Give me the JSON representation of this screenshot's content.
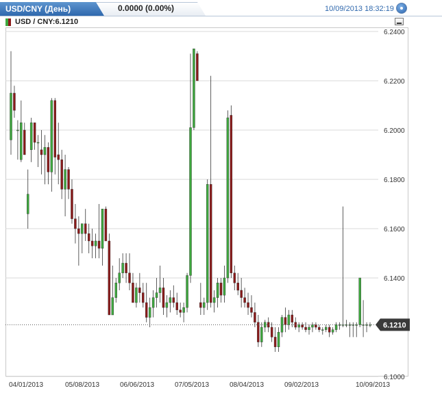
{
  "header": {
    "title": "USD/CNY (День)",
    "change": "0.0000 (0.00%)",
    "timestamp": "10/09/2013 18:32:19"
  },
  "legend": {
    "label": "USD / CNY:6.1210"
  },
  "colors": {
    "up": "#3ea83e",
    "down": "#8b1a1a",
    "accent": "#2f68ad",
    "price_marker": "#3a3a3a"
  },
  "chart_data": {
    "type": "candlestick",
    "title": "USD / CNY",
    "x_tick_labels": [
      "04/01/2013",
      "05/08/2013",
      "06/06/2013",
      "07/05/2013",
      "08/04/2013",
      "09/02/2013",
      "10/09/2013"
    ],
    "y_tick_labels": [
      "6.2400",
      "6.2200",
      "6.2000",
      "6.1800",
      "6.1600",
      "6.1400",
      "6.1210",
      "6.1000"
    ],
    "ylim": [
      6.1,
      6.24
    ],
    "last_price": 6.121,
    "last_price_label": "6.1210",
    "grid": true,
    "candles": [
      [
        6.196,
        6.232,
        6.19,
        6.215
      ],
      [
        6.215,
        6.218,
        6.205,
        6.208
      ],
      [
        6.2,
        6.204,
        6.188,
        6.2
      ],
      [
        6.188,
        6.212,
        6.187,
        6.203
      ],
      [
        6.2,
        6.203,
        6.195,
        6.19
      ],
      [
        6.166,
        6.184,
        6.16,
        6.174
      ],
      [
        6.192,
        6.205,
        6.187,
        6.203
      ],
      [
        6.203,
        6.2,
        6.192,
        6.195
      ],
      [
        6.195,
        6.198,
        6.185,
        6.195
      ],
      [
        6.192,
        6.2,
        6.182,
        6.19
      ],
      [
        6.19,
        6.198,
        6.178,
        6.193
      ],
      [
        6.193,
        6.195,
        6.178,
        6.183
      ],
      [
        6.183,
        6.213,
        6.175,
        6.212
      ],
      [
        6.212,
        6.213,
        6.182,
        6.189
      ],
      [
        6.19,
        6.203,
        6.178,
        6.188
      ],
      [
        6.188,
        6.192,
        6.172,
        6.176
      ],
      [
        6.176,
        6.19,
        6.165,
        6.184
      ],
      [
        6.184,
        6.185,
        6.172,
        6.176
      ],
      [
        6.176,
        6.18,
        6.162,
        6.164
      ],
      [
        6.164,
        6.17,
        6.154,
        6.16
      ],
      [
        6.16,
        6.165,
        6.145,
        6.158
      ],
      [
        6.158,
        6.162,
        6.15,
        6.162
      ],
      [
        6.162,
        6.168,
        6.155,
        6.158
      ],
      [
        6.158,
        6.162,
        6.15,
        6.155
      ],
      [
        6.155,
        6.16,
        6.148,
        6.153
      ],
      [
        6.153,
        6.158,
        6.148,
        6.155
      ],
      [
        6.155,
        6.17,
        6.148,
        6.152
      ],
      [
        6.152,
        6.166,
        6.145,
        6.168
      ],
      [
        6.168,
        6.169,
        6.158,
        6.155
      ],
      [
        6.155,
        6.158,
        6.125,
        6.125
      ],
      [
        6.125,
        6.145,
        6.125,
        6.132
      ],
      [
        6.132,
        6.14,
        6.13,
        6.138
      ],
      [
        6.138,
        6.148,
        6.135,
        6.142
      ],
      [
        6.142,
        6.15,
        6.14,
        6.146
      ],
      [
        6.146,
        6.15,
        6.138,
        6.142
      ],
      [
        6.142,
        6.15,
        6.135,
        6.138
      ],
      [
        6.138,
        6.142,
        6.13,
        6.13
      ],
      [
        6.13,
        6.138,
        6.128,
        6.136
      ],
      [
        6.136,
        6.142,
        6.13,
        6.134
      ],
      [
        6.134,
        6.138,
        6.128,
        6.13
      ],
      [
        6.13,
        6.138,
        6.122,
        6.124
      ],
      [
        6.124,
        6.132,
        6.12,
        6.128
      ],
      [
        6.128,
        6.135,
        6.124,
        6.132
      ],
      [
        6.132,
        6.14,
        6.128,
        6.134
      ],
      [
        6.134,
        6.145,
        6.13,
        6.136
      ],
      [
        6.136,
        6.14,
        6.125,
        6.128
      ],
      [
        6.128,
        6.133,
        6.124,
        6.13
      ],
      [
        6.13,
        6.135,
        6.126,
        6.132
      ],
      [
        6.132,
        6.137,
        6.128,
        6.13
      ],
      [
        6.13,
        6.134,
        6.125,
        6.127
      ],
      [
        6.127,
        6.13,
        6.124,
        6.126
      ],
      [
        6.126,
        6.13,
        6.122,
        6.128
      ],
      [
        6.128,
        6.142,
        6.126,
        6.141
      ],
      [
        6.141,
        6.231,
        6.138,
        6.201
      ],
      [
        6.201,
        6.233,
        6.2,
        6.233
      ],
      [
        6.231,
        6.232,
        6.22,
        6.22
      ],
      [
        6.13,
        6.138,
        6.125,
        6.128
      ],
      [
        6.128,
        6.132,
        6.125,
        6.13
      ],
      [
        6.13,
        6.18,
        6.127,
        6.178
      ],
      [
        6.178,
        6.222,
        6.128,
        6.13
      ],
      [
        6.13,
        6.135,
        6.126,
        6.132
      ],
      [
        6.132,
        6.14,
        6.128,
        6.138
      ],
      [
        6.138,
        6.14,
        6.13,
        6.133
      ],
      [
        6.133,
        6.145,
        6.13,
        6.14
      ],
      [
        6.14,
        6.208,
        6.138,
        6.205
      ],
      [
        6.206,
        6.21,
        6.14,
        6.142
      ],
      [
        6.142,
        6.145,
        6.135,
        6.138
      ],
      [
        6.138,
        6.142,
        6.133,
        6.135
      ],
      [
        6.135,
        6.14,
        6.128,
        6.132
      ],
      [
        6.132,
        6.136,
        6.128,
        6.13
      ],
      [
        6.13,
        6.134,
        6.125,
        6.128
      ],
      [
        6.128,
        6.133,
        6.124,
        6.126
      ],
      [
        6.126,
        6.13,
        6.12,
        6.122
      ],
      [
        6.122,
        6.125,
        6.112,
        6.114
      ],
      [
        6.114,
        6.122,
        6.112,
        6.12
      ],
      [
        6.12,
        6.123,
        6.118,
        6.122
      ],
      [
        6.122,
        6.124,
        6.118,
        6.12
      ],
      [
        6.12,
        6.122,
        6.114,
        6.116
      ],
      [
        6.116,
        6.12,
        6.11,
        6.112
      ],
      [
        6.112,
        6.12,
        6.11,
        6.118
      ],
      [
        6.118,
        6.125,
        6.116,
        6.124
      ],
      [
        6.124,
        6.128,
        6.118,
        6.121
      ],
      [
        6.121,
        6.127,
        6.119,
        6.125
      ],
      [
        6.125,
        6.127,
        6.12,
        6.122
      ],
      [
        6.122,
        6.124,
        6.119,
        6.12
      ],
      [
        6.12,
        6.122,
        6.118,
        6.121
      ],
      [
        6.121,
        6.122,
        6.119,
        6.12
      ],
      [
        6.12,
        6.122,
        6.118,
        6.119
      ],
      [
        6.119,
        6.121,
        6.117,
        6.12
      ],
      [
        6.12,
        6.122,
        6.118,
        6.121
      ],
      [
        6.121,
        6.122,
        6.119,
        6.12
      ],
      [
        6.12,
        6.121,
        6.118,
        6.119
      ],
      [
        6.119,
        6.12,
        6.117,
        6.119
      ],
      [
        6.119,
        6.121,
        6.118,
        6.12
      ],
      [
        6.12,
        6.121,
        6.116,
        6.118
      ],
      [
        6.118,
        6.12,
        6.117,
        6.119
      ],
      [
        6.119,
        6.122,
        6.118,
        6.121
      ],
      [
        6.121,
        6.122,
        6.119,
        6.121
      ],
      [
        6.121,
        6.169,
        6.12,
        6.121
      ],
      [
        6.121,
        6.123,
        6.12,
        6.121
      ],
      [
        6.121,
        6.122,
        6.116,
        6.121
      ],
      [
        6.121,
        6.122,
        6.116,
        6.121
      ],
      [
        6.121,
        6.122,
        6.116,
        6.121
      ],
      [
        6.121,
        6.14,
        6.12,
        6.14
      ],
      [
        6.121,
        6.131,
        6.116,
        6.121
      ],
      [
        6.121,
        6.122,
        6.118,
        6.121
      ],
      [
        6.121,
        6.122,
        6.12,
        6.121
      ]
    ]
  }
}
